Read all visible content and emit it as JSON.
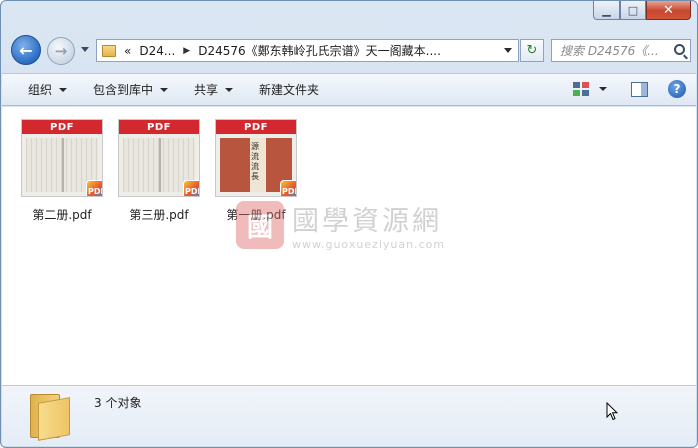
{
  "window": {
    "minimize_glyph": "▁",
    "maximize_glyph": "□",
    "close_glyph": "✕"
  },
  "nav": {
    "back_glyph": "←",
    "forward_glyph": "→"
  },
  "address": {
    "breadcrumb": [
      "«",
      "D24...",
      "D24576《鄭东韩岭孔氏宗谱》天一阁藏本...."
    ],
    "refresh_glyph": "↻"
  },
  "search": {
    "placeholder": "搜索 D24576《...",
    "icon": "search-icon"
  },
  "toolbar": {
    "items": [
      "组织",
      "包含到库中",
      "共享",
      "新建文件夹"
    ],
    "has_dropdown": [
      true,
      true,
      true,
      false
    ],
    "help_glyph": "?"
  },
  "files": [
    {
      "name": "第二册.pdf",
      "banner": "PDF",
      "badge": "PDF",
      "thumb": "scan"
    },
    {
      "name": "第三册.pdf",
      "banner": "PDF",
      "badge": "PDF",
      "thumb": "scan"
    },
    {
      "name": "第一册.pdf",
      "banner": "PDF",
      "badge": "PDF",
      "thumb": "cover"
    }
  ],
  "watermark": {
    "logo_char": "國",
    "chinese": "國學資源網",
    "url": "www.guoxueziyuan.com"
  },
  "details": {
    "status": "3 个对象"
  },
  "colors": {
    "pdf_banner": "#d4282f",
    "window_frame": "#6f8fb5",
    "close_button": "#c8462e"
  }
}
